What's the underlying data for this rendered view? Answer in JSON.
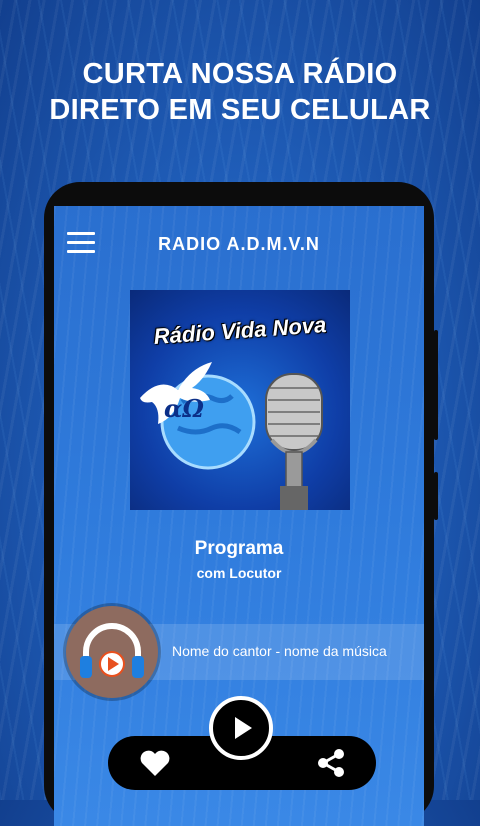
{
  "promo": {
    "line1": "CURTA NOSSA RÁDIO",
    "line2": "DIRETO EM SEU CELULAR"
  },
  "app": {
    "title": "RADIO A.D.M.V.N",
    "menu_icon": "hamburger-menu-icon"
  },
  "cover": {
    "title": "Rádio Vida Nova",
    "letters": "αΩ",
    "elements": [
      "dove",
      "globe",
      "microphone"
    ]
  },
  "program": {
    "title": "Programa",
    "subtitle": "com Locutor"
  },
  "now_playing": {
    "text": "Nome do cantor - nome da música",
    "icon": "headphones-play-icon"
  },
  "controls": {
    "heart_icon": "heart-icon",
    "play_icon": "play-icon",
    "share_icon": "share-icon"
  },
  "colors": {
    "background": "#1f5db8",
    "screen": "#2f7bdc",
    "bar": "#000000",
    "disc": "#8e6b5f",
    "headphones_accent": "#e8501e"
  }
}
